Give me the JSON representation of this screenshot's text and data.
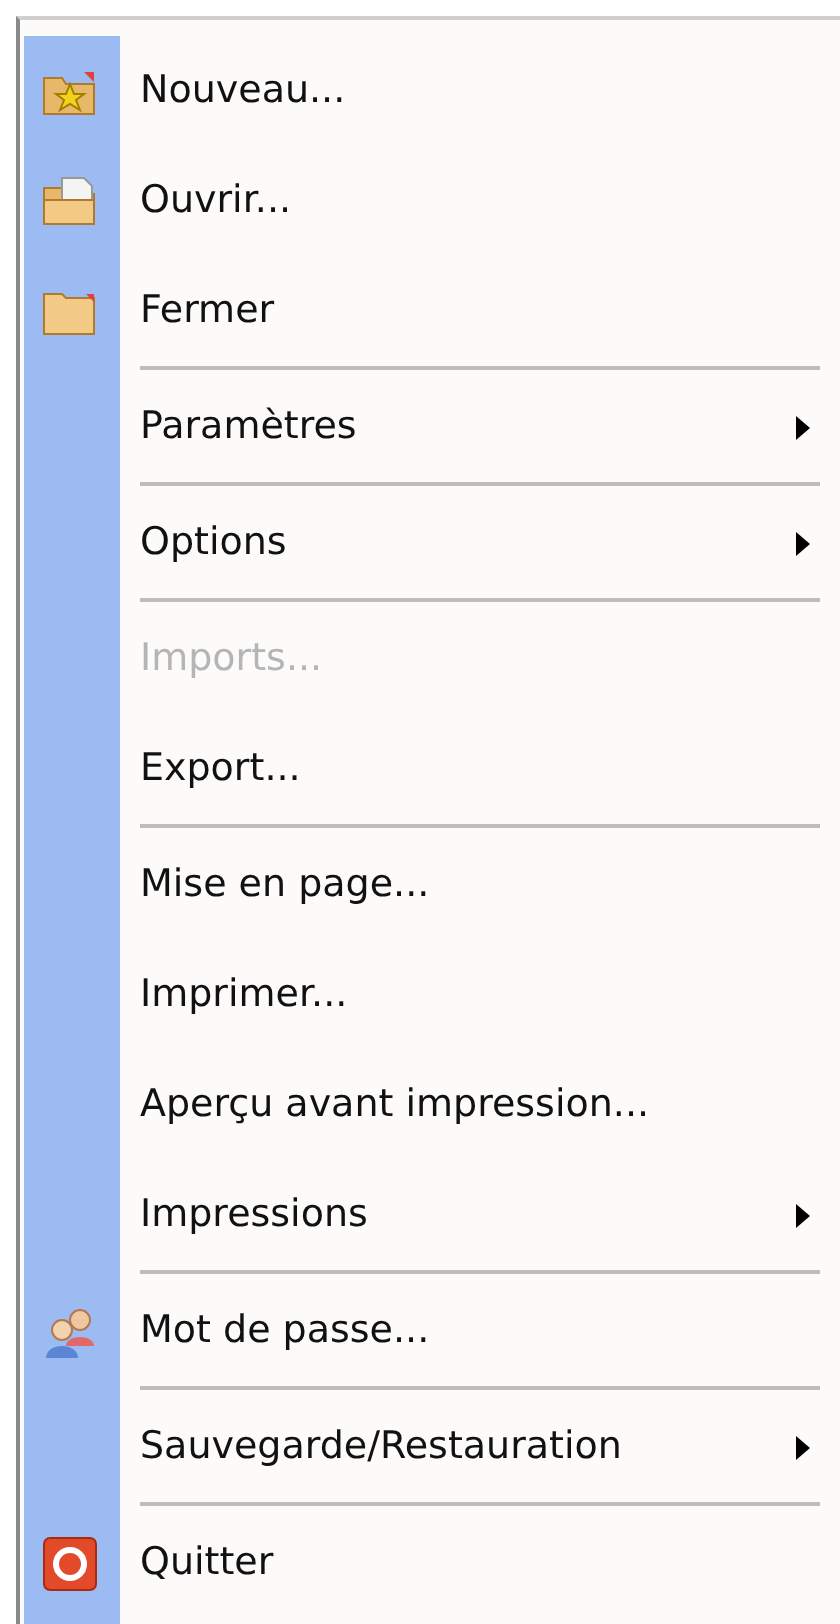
{
  "menu": {
    "items": [
      {
        "kind": "item",
        "label": "Nouveau...",
        "submenu": false,
        "disabled": false
      },
      {
        "kind": "item",
        "label": "Ouvrir...",
        "submenu": false,
        "disabled": false
      },
      {
        "kind": "item",
        "label": "Fermer",
        "submenu": false,
        "disabled": false
      },
      {
        "kind": "separator"
      },
      {
        "kind": "item",
        "label": "Paramètres",
        "submenu": true,
        "disabled": false
      },
      {
        "kind": "separator"
      },
      {
        "kind": "item",
        "label": "Options",
        "submenu": true,
        "disabled": false
      },
      {
        "kind": "separator"
      },
      {
        "kind": "item",
        "label": "Imports...",
        "submenu": false,
        "disabled": true
      },
      {
        "kind": "item",
        "label": "Export...",
        "submenu": false,
        "disabled": false
      },
      {
        "kind": "separator"
      },
      {
        "kind": "item",
        "label": "Mise en page...",
        "submenu": false,
        "disabled": false
      },
      {
        "kind": "item",
        "label": "Imprimer...",
        "submenu": false,
        "disabled": false
      },
      {
        "kind": "item",
        "label": "Aperçu avant impression...",
        "submenu": false,
        "disabled": false
      },
      {
        "kind": "item",
        "label": "Impressions",
        "submenu": true,
        "disabled": false
      },
      {
        "kind": "separator"
      },
      {
        "kind": "item",
        "label": "Mot de passe...",
        "submenu": false,
        "disabled": false
      },
      {
        "kind": "separator"
      },
      {
        "kind": "item",
        "label": "Sauvegarde/Restauration",
        "submenu": true,
        "disabled": false
      },
      {
        "kind": "separator"
      },
      {
        "kind": "item",
        "label": "Quitter",
        "submenu": false,
        "disabled": false
      }
    ]
  }
}
